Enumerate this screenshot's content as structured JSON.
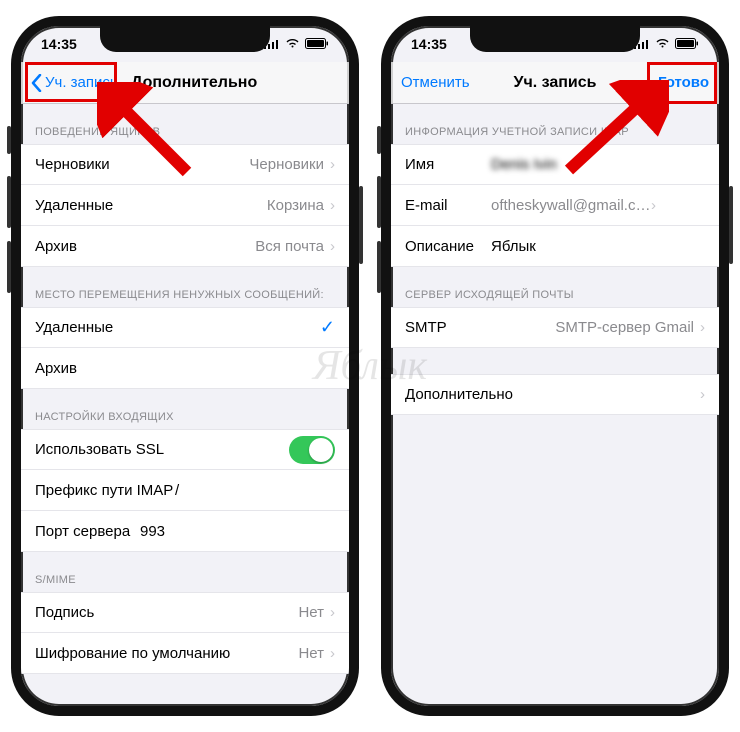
{
  "watermark": "Яблык",
  "status": {
    "time": "14:35"
  },
  "colors": {
    "tint": "#007aff",
    "highlight": "#e10000",
    "switch_on": "#34c759"
  },
  "left": {
    "nav": {
      "back": "Уч. запись",
      "title": "Дополнительно"
    },
    "section_mailbox": "Поведение ящиков",
    "mailbox": {
      "drafts_label": "Черновики",
      "drafts_value": "Черновики",
      "deleted_label": "Удаленные",
      "deleted_value": "Корзина",
      "archive_label": "Архив",
      "archive_value": "Вся почта"
    },
    "section_move": "Место перемещения ненужных сообщений:",
    "move": {
      "deleted": "Удаленные",
      "archive": "Архив",
      "selected": "deleted"
    },
    "section_incoming": "Настройки входящих",
    "incoming": {
      "ssl": "Использовать SSL",
      "ssl_on": true,
      "imap_prefix_label": "Префикс пути IMAP",
      "imap_prefix_value": "/",
      "port_label": "Порт сервера",
      "port_value": "993"
    },
    "section_smime": "S/MIME",
    "smime": {
      "sign_label": "Подпись",
      "sign_value": "Нет",
      "encrypt_label": "Шифрование по умолчанию",
      "encrypt_value": "Нет"
    }
  },
  "right": {
    "nav": {
      "cancel": "Отменить",
      "title": "Уч. запись",
      "done": "Готово"
    },
    "section_info": "Информация учетной записи IMAP",
    "info": {
      "name_label": "Имя",
      "name_value": "Denis Ivin",
      "email_label": "E-mail",
      "email_value": "oftheskywall@gmail.com",
      "desc_label": "Описание",
      "desc_value": "Яблык"
    },
    "section_outgoing": "Сервер исходящей почты",
    "outgoing": {
      "smtp_label": "SMTP",
      "smtp_value": "SMTP-сервер Gmail"
    },
    "advanced": "Дополнительно"
  }
}
